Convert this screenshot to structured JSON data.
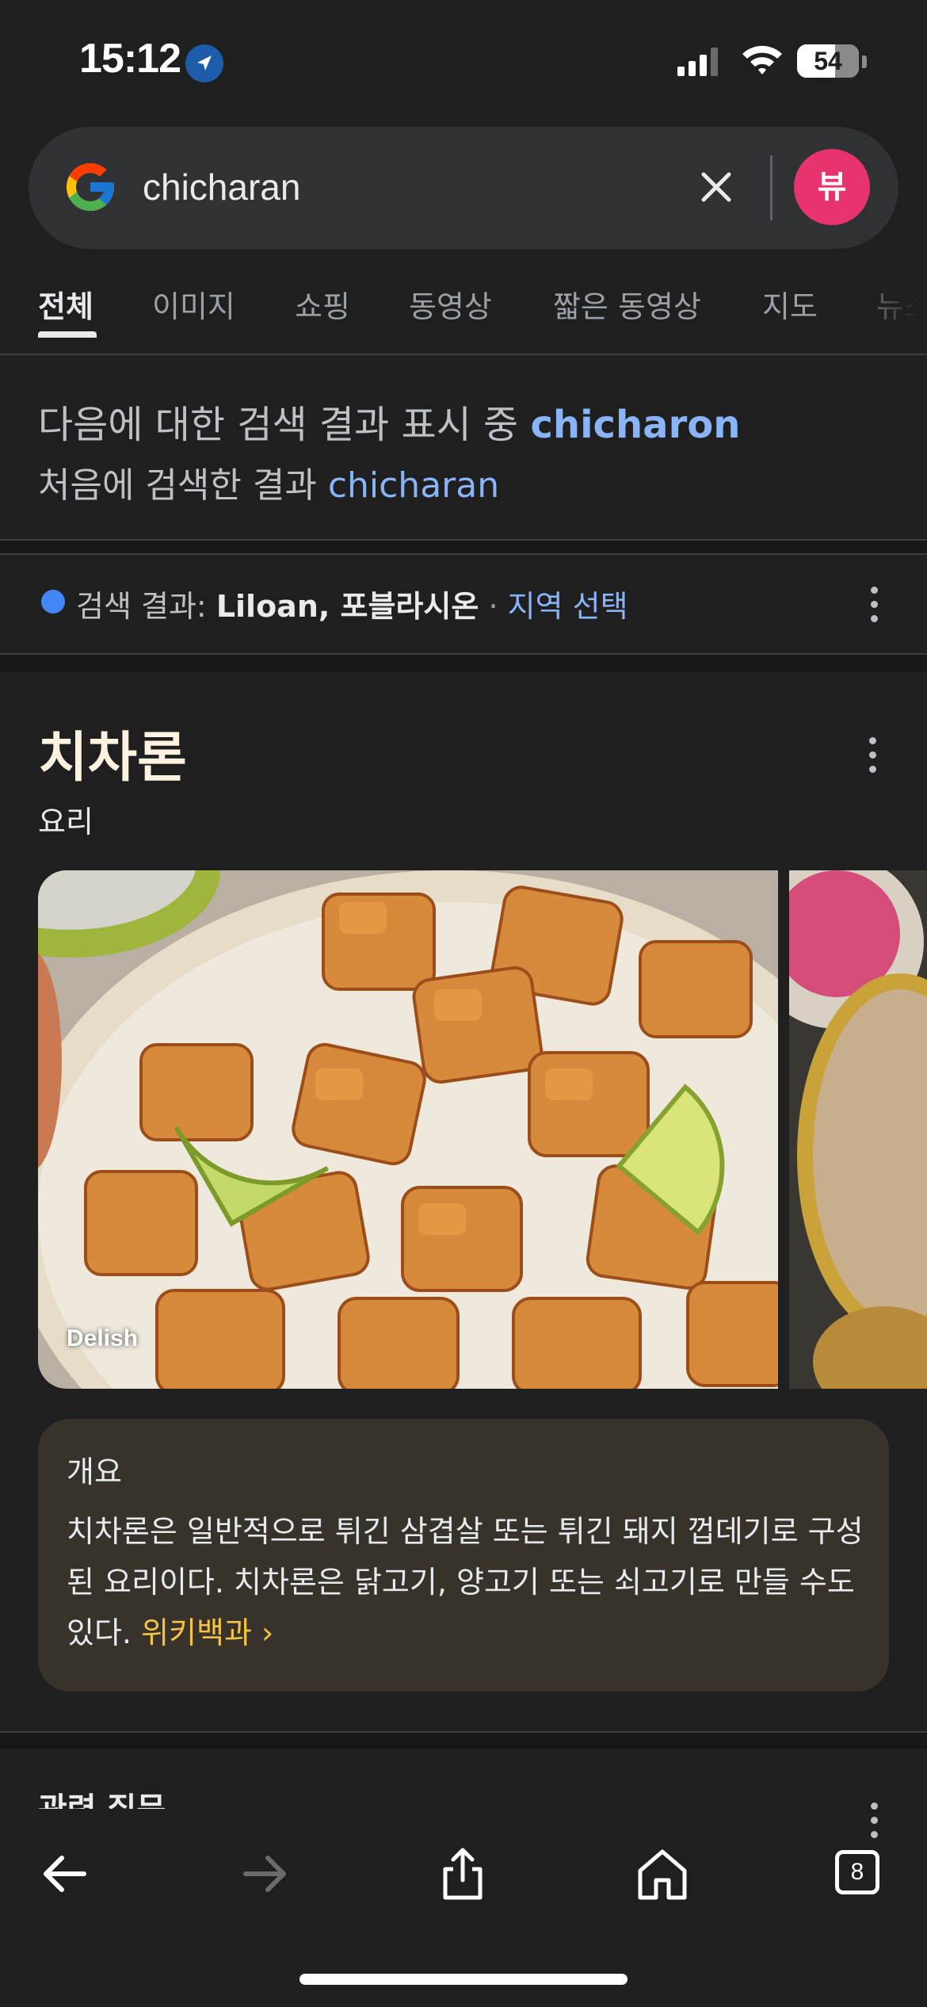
{
  "status_bar": {
    "time": "15:12",
    "battery": "54"
  },
  "search": {
    "query": "chicharan",
    "avatar_initial": "뷰"
  },
  "tabs": [
    {
      "label": "전체"
    },
    {
      "label": "이미지"
    },
    {
      "label": "쇼핑"
    },
    {
      "label": "동영상"
    },
    {
      "label": "짧은 동영상"
    },
    {
      "label": "지도"
    },
    {
      "label": "뉴스"
    }
  ],
  "spelling": {
    "showing_prefix": "다음에 대한 검색 결과 표시 중 ",
    "corrected_term": "chicharon",
    "original_prefix": "처음에 검색한 결과 ",
    "original_term": "chicharan"
  },
  "location": {
    "prefix": "검색 결과: ",
    "place": "Liloan, 포블라시온",
    "separator": " · ",
    "change_link": "지역 선택"
  },
  "knowledge_panel": {
    "title": "치차론",
    "subtitle": "요리",
    "image_credit": "Delish",
    "overview_title": "개요",
    "overview_text": "치차론은 일반적으로 튀긴 삼겹살 또는 튀긴 돼지 껍데기로 구성된 요리이다. 치차론은 닭고기, 양고기 또는 쇠고기로 만들 수도 있다. ",
    "source_link": "위키백과",
    "source_chevron": "›"
  },
  "related": {
    "title": "관련 질문"
  },
  "toolbar": {
    "tab_count": "8"
  },
  "colors": {
    "background": "#1f1f1f",
    "link_blue": "#8ab4f8",
    "wiki_link": "#f6c344",
    "avatar": "#e8336d",
    "overview_card": "#37332b"
  },
  "icons": [
    "location-arrow-icon",
    "signal-icon",
    "wifi-icon",
    "battery-icon",
    "google-logo",
    "clear-icon",
    "more-icon",
    "back-icon",
    "forward-icon",
    "share-icon",
    "home-icon",
    "tabs-icon"
  ]
}
